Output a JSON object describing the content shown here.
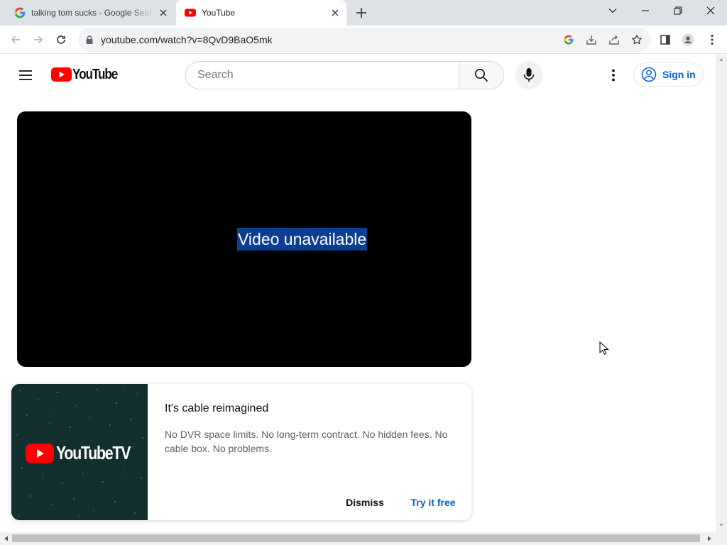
{
  "browser": {
    "tabs": [
      {
        "title": "talking tom sucks - Google Search",
        "active": false,
        "icon": "google-g-icon"
      },
      {
        "title": "YouTube",
        "active": true,
        "icon": "youtube-favicon-icon"
      }
    ],
    "url": "youtube.com/watch?v=8QvD9BaO5mk"
  },
  "youtube": {
    "logo_text": "YouTube",
    "search_placeholder": "Search",
    "signin_label": "Sign in",
    "player_message": "Video unavailable",
    "promo": {
      "logo_text": "YouTubeTV",
      "title": "It's cable reimagined",
      "description": "No DVR space limits. No long-term contract. No hidden fees. No cable box. No problems.",
      "dismiss_label": "Dismiss",
      "cta_label": "Try it free"
    }
  },
  "colors": {
    "youtube_red": "#ff0000",
    "link_blue": "#065fd4",
    "selection_blue": "#0b3d91",
    "tabstrip": "#dee1e6"
  }
}
